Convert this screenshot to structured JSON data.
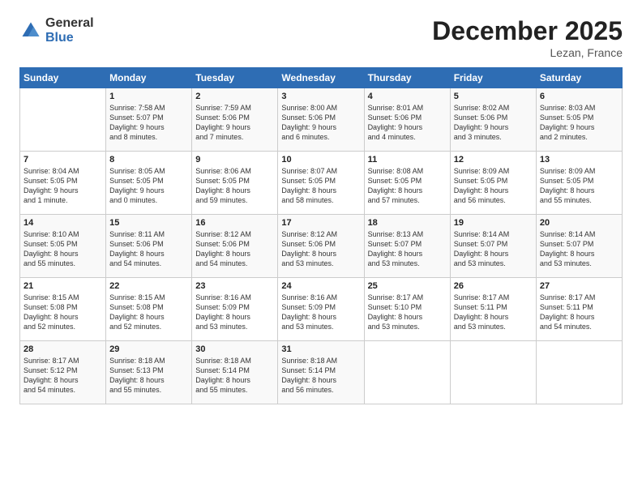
{
  "logo": {
    "general": "General",
    "blue": "Blue"
  },
  "title": "December 2025",
  "location": "Lezan, France",
  "days_of_week": [
    "Sunday",
    "Monday",
    "Tuesday",
    "Wednesday",
    "Thursday",
    "Friday",
    "Saturday"
  ],
  "weeks": [
    [
      {
        "day": "",
        "info": ""
      },
      {
        "day": "1",
        "info": "Sunrise: 7:58 AM\nSunset: 5:07 PM\nDaylight: 9 hours\nand 8 minutes."
      },
      {
        "day": "2",
        "info": "Sunrise: 7:59 AM\nSunset: 5:06 PM\nDaylight: 9 hours\nand 7 minutes."
      },
      {
        "day": "3",
        "info": "Sunrise: 8:00 AM\nSunset: 5:06 PM\nDaylight: 9 hours\nand 6 minutes."
      },
      {
        "day": "4",
        "info": "Sunrise: 8:01 AM\nSunset: 5:06 PM\nDaylight: 9 hours\nand 4 minutes."
      },
      {
        "day": "5",
        "info": "Sunrise: 8:02 AM\nSunset: 5:06 PM\nDaylight: 9 hours\nand 3 minutes."
      },
      {
        "day": "6",
        "info": "Sunrise: 8:03 AM\nSunset: 5:05 PM\nDaylight: 9 hours\nand 2 minutes."
      }
    ],
    [
      {
        "day": "7",
        "info": "Sunrise: 8:04 AM\nSunset: 5:05 PM\nDaylight: 9 hours\nand 1 minute."
      },
      {
        "day": "8",
        "info": "Sunrise: 8:05 AM\nSunset: 5:05 PM\nDaylight: 9 hours\nand 0 minutes."
      },
      {
        "day": "9",
        "info": "Sunrise: 8:06 AM\nSunset: 5:05 PM\nDaylight: 8 hours\nand 59 minutes."
      },
      {
        "day": "10",
        "info": "Sunrise: 8:07 AM\nSunset: 5:05 PM\nDaylight: 8 hours\nand 58 minutes."
      },
      {
        "day": "11",
        "info": "Sunrise: 8:08 AM\nSunset: 5:05 PM\nDaylight: 8 hours\nand 57 minutes."
      },
      {
        "day": "12",
        "info": "Sunrise: 8:09 AM\nSunset: 5:05 PM\nDaylight: 8 hours\nand 56 minutes."
      },
      {
        "day": "13",
        "info": "Sunrise: 8:09 AM\nSunset: 5:05 PM\nDaylight: 8 hours\nand 55 minutes."
      }
    ],
    [
      {
        "day": "14",
        "info": "Sunrise: 8:10 AM\nSunset: 5:05 PM\nDaylight: 8 hours\nand 55 minutes."
      },
      {
        "day": "15",
        "info": "Sunrise: 8:11 AM\nSunset: 5:06 PM\nDaylight: 8 hours\nand 54 minutes."
      },
      {
        "day": "16",
        "info": "Sunrise: 8:12 AM\nSunset: 5:06 PM\nDaylight: 8 hours\nand 54 minutes."
      },
      {
        "day": "17",
        "info": "Sunrise: 8:12 AM\nSunset: 5:06 PM\nDaylight: 8 hours\nand 53 minutes."
      },
      {
        "day": "18",
        "info": "Sunrise: 8:13 AM\nSunset: 5:07 PM\nDaylight: 8 hours\nand 53 minutes."
      },
      {
        "day": "19",
        "info": "Sunrise: 8:14 AM\nSunset: 5:07 PM\nDaylight: 8 hours\nand 53 minutes."
      },
      {
        "day": "20",
        "info": "Sunrise: 8:14 AM\nSunset: 5:07 PM\nDaylight: 8 hours\nand 53 minutes."
      }
    ],
    [
      {
        "day": "21",
        "info": "Sunrise: 8:15 AM\nSunset: 5:08 PM\nDaylight: 8 hours\nand 52 minutes."
      },
      {
        "day": "22",
        "info": "Sunrise: 8:15 AM\nSunset: 5:08 PM\nDaylight: 8 hours\nand 52 minutes."
      },
      {
        "day": "23",
        "info": "Sunrise: 8:16 AM\nSunset: 5:09 PM\nDaylight: 8 hours\nand 53 minutes."
      },
      {
        "day": "24",
        "info": "Sunrise: 8:16 AM\nSunset: 5:09 PM\nDaylight: 8 hours\nand 53 minutes."
      },
      {
        "day": "25",
        "info": "Sunrise: 8:17 AM\nSunset: 5:10 PM\nDaylight: 8 hours\nand 53 minutes."
      },
      {
        "day": "26",
        "info": "Sunrise: 8:17 AM\nSunset: 5:11 PM\nDaylight: 8 hours\nand 53 minutes."
      },
      {
        "day": "27",
        "info": "Sunrise: 8:17 AM\nSunset: 5:11 PM\nDaylight: 8 hours\nand 54 minutes."
      }
    ],
    [
      {
        "day": "28",
        "info": "Sunrise: 8:17 AM\nSunset: 5:12 PM\nDaylight: 8 hours\nand 54 minutes."
      },
      {
        "day": "29",
        "info": "Sunrise: 8:18 AM\nSunset: 5:13 PM\nDaylight: 8 hours\nand 55 minutes."
      },
      {
        "day": "30",
        "info": "Sunrise: 8:18 AM\nSunset: 5:14 PM\nDaylight: 8 hours\nand 55 minutes."
      },
      {
        "day": "31",
        "info": "Sunrise: 8:18 AM\nSunset: 5:14 PM\nDaylight: 8 hours\nand 56 minutes."
      },
      {
        "day": "",
        "info": ""
      },
      {
        "day": "",
        "info": ""
      },
      {
        "day": "",
        "info": ""
      }
    ]
  ]
}
